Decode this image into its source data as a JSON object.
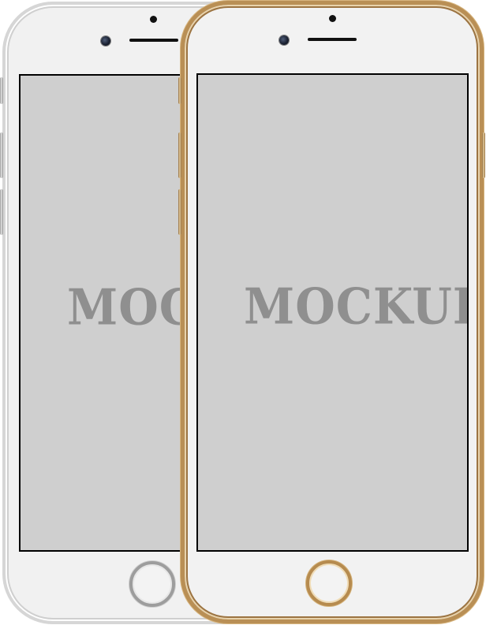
{
  "mockups": [
    {
      "finish": "silver",
      "screen_text": "MOCKUP",
      "frame_color": "#d6d6d6",
      "screen_color": "#cfcfcf"
    },
    {
      "finish": "gold",
      "screen_text": "MOCKUP",
      "frame_color": "#b98f55",
      "screen_color": "#cfcfcf"
    }
  ],
  "text_color": "#8f8f8f"
}
